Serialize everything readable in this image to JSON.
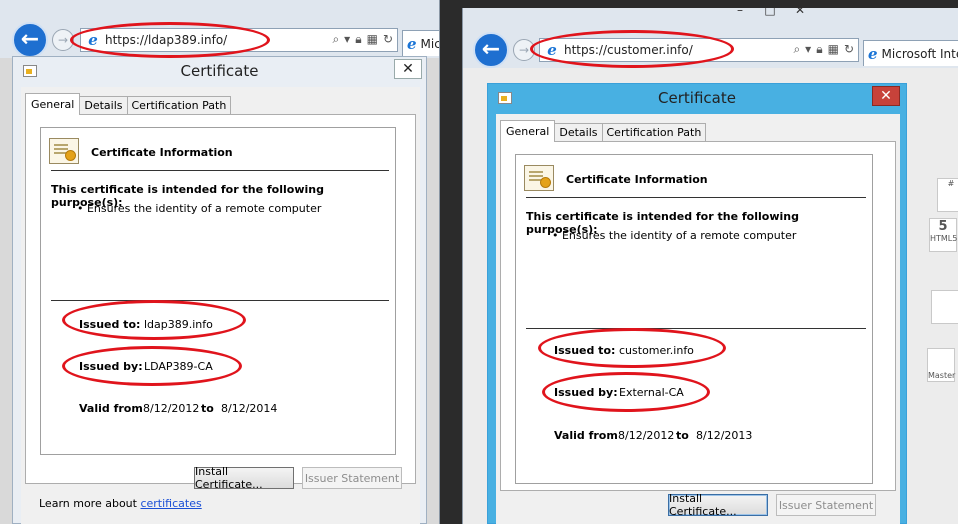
{
  "left": {
    "url": "https://ldap389.info/",
    "tab_label": "Micros",
    "dialog_title": "Certificate",
    "tabs": [
      "General",
      "Details",
      "Certification Path"
    ],
    "cert_heading": "Certificate Information",
    "purpose_heading": "This certificate is intended for the following purpose(s):",
    "purpose_item": "• Ensures the identity of a remote computer",
    "issued_to_label": "Issued to:",
    "issued_to": "ldap389.info",
    "issued_by_label": "Issued by:",
    "issued_by": "LDAP389-CA",
    "valid_from_label": "Valid from",
    "valid_from": "8/12/2012",
    "valid_to_label": "to",
    "valid_to": "8/12/2014",
    "install_btn": "Install Certificate...",
    "issuer_btn": "Issuer Statement",
    "learn_prefix": "Learn more about ",
    "learn_link": "certificates"
  },
  "right": {
    "url": "https://customer.info/",
    "tab_label": "Microsoft Inte",
    "dialog_title": "Certificate",
    "tabs": [
      "General",
      "Details",
      "Certification Path"
    ],
    "cert_heading": "Certificate Information",
    "purpose_heading": "This certificate is intended for the following purpose(s):",
    "purpose_item": "• Ensures the identity of a remote computer",
    "issued_to_label": "Issued to:",
    "issued_to": "customer.info",
    "issued_by_label": "Issued by:",
    "issued_by": "External-CA",
    "valid_from_label": "Valid from",
    "valid_from": "8/12/2012",
    "valid_to_label": "to",
    "valid_to": "8/12/2013",
    "install_btn": "Install Certificate...",
    "issuer_btn": "Issuer Statement"
  },
  "icons": {
    "back": "back-arrow-icon",
    "forward": "forward-arrow-icon",
    "search": "search-icon",
    "lock": "lock-icon",
    "refresh": "refresh-icon",
    "close": "close-icon",
    "ie": "internet-explorer-icon",
    "certificate": "certificate-icon"
  },
  "colors": {
    "highlight_oval": "#e0141c",
    "active_dialog_frame": "#48b0e2",
    "close_button_active": "#c7423a",
    "link": "#1a4fd6"
  },
  "decor": {
    "file_icon_1": "5",
    "file_icon_1_label": "HTML5",
    "file_icon_2": "Master",
    "file_icon_3": "#"
  }
}
